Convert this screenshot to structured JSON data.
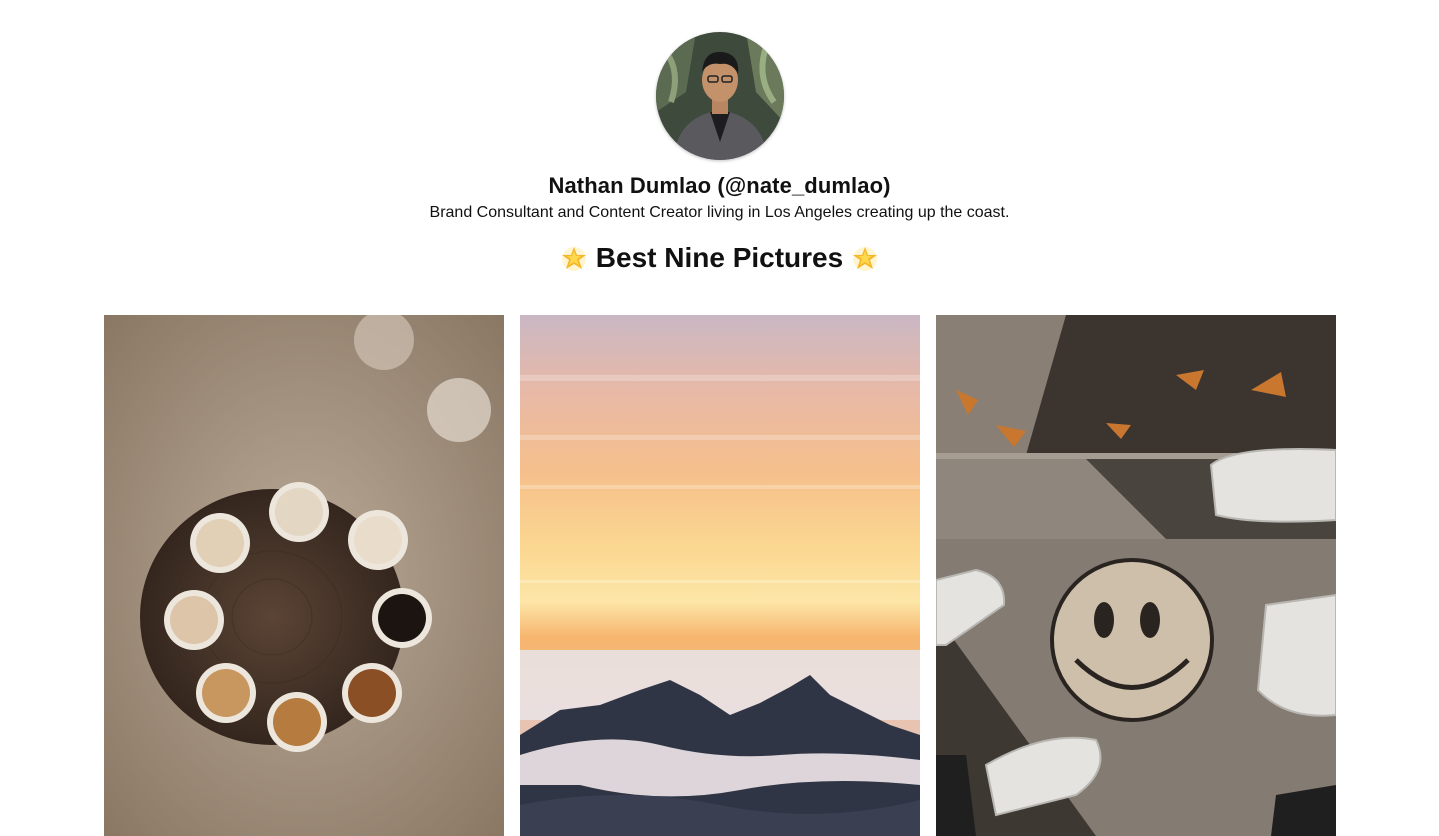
{
  "profile": {
    "name_line": "Nathan Dumlao (@nate_dumlao)",
    "bio": "Brand Consultant and Content Creator living in Los Angeles creating up the coast.",
    "avatar_alt": "Nathan Dumlao avatar"
  },
  "section": {
    "title": "Best Nine Pictures",
    "left_icon": "glowing-star-icon",
    "right_icon": "glowing-star-icon"
  },
  "photos": [
    {
      "alt": "Coffee cups arranged in a circle on a wooden stool"
    },
    {
      "alt": "Sunset sky over mountains above clouds"
    },
    {
      "alt": "Sneakers around a smiley face painted on sidewalk"
    }
  ]
}
